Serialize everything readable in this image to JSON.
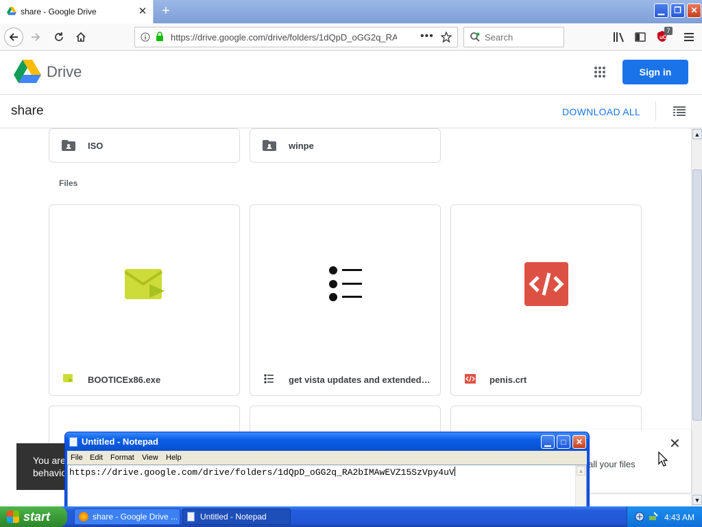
{
  "browser": {
    "tab_title": "share - Google Drive",
    "url": "https://drive.google.com/drive/folders/1dQpD_oGG2q_RA",
    "search_placeholder": "Search",
    "badge_count": "7",
    "colors": {
      "title_strip": "#7e9fd8",
      "lock": "#12bc00",
      "ublock": "#c20016"
    }
  },
  "drive": {
    "brand": "Drive",
    "sign_in": "Sign in",
    "folder_name": "share",
    "download_all": "DOWNLOAD ALL",
    "folders": [
      {
        "name": "ISO"
      },
      {
        "name": "winpe"
      }
    ],
    "files_label": "Files",
    "files": [
      {
        "name": "BOOTICEx86.exe",
        "icon": "exe-file-icon"
      },
      {
        "name": "get vista updates and extended kernel.txt",
        "icon": "list-file-icon"
      },
      {
        "name": "penis.crt",
        "icon": "code-file-icon"
      }
    ],
    "toast_text": "You are behavio",
    "banner_text": "all your files",
    "colors": {
      "primary": "#1a73e8",
      "code_icon": "#dd5144",
      "exe_icon": "#cddc39"
    }
  },
  "notepad": {
    "title": "Untitled - Notepad",
    "menu": [
      "File",
      "Edit",
      "Format",
      "View",
      "Help"
    ],
    "content": "https://drive.google.com/drive/folders/1dQpD_oGG2q_RA2bIMAwEVZ15SzVpy4uV"
  },
  "taskbar": {
    "start": "start",
    "tasks": [
      "share - Google Drive ...",
      "Untitled - Notepad"
    ],
    "clock": "4:43 AM"
  }
}
